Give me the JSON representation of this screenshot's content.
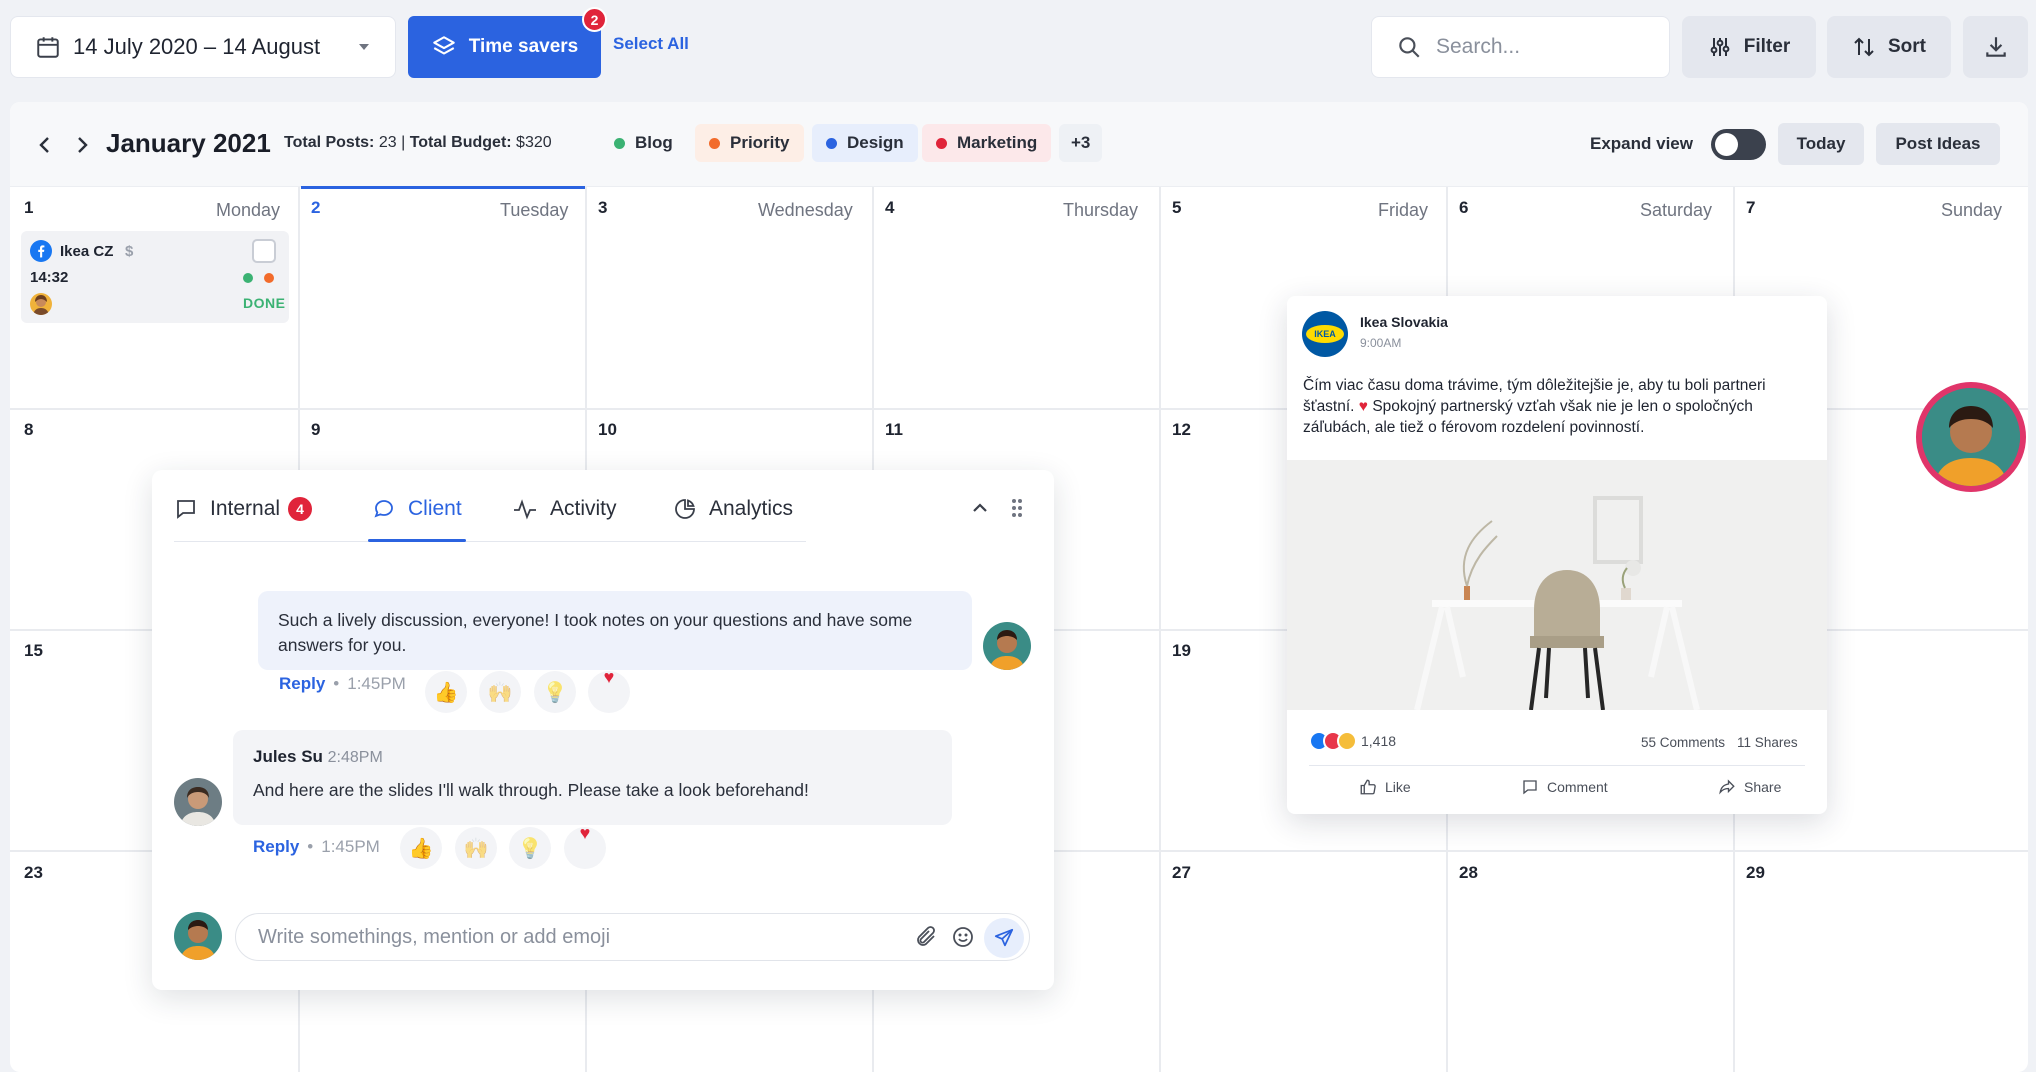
{
  "toolbar": {
    "date_range": "14 July 2020 – 14 August",
    "time_savers_label": "Time savers",
    "time_savers_badge": "2",
    "select_all": "Select All",
    "search_placeholder": "Search...",
    "filter_label": "Filter",
    "sort_label": "Sort"
  },
  "calendar_header": {
    "month": "January 2021",
    "totals_prefix": "Total Posts:",
    "total_posts": "23",
    "totals_sep": "|",
    "budget_prefix": "Total Budget:",
    "total_budget": "$320",
    "tags": [
      {
        "label": "Blog",
        "color": "#3bb273",
        "bg": "#eef1f5"
      },
      {
        "label": "Priority",
        "color": "#f26b2b",
        "bg": "#fdeee6"
      },
      {
        "label": "Design",
        "color": "#2b63e0",
        "bg": "#e7eefc"
      },
      {
        "label": "Marketing",
        "color": "#e0243a",
        "bg": "#fce8ea"
      },
      {
        "label": "+3",
        "color": "",
        "bg": "#eef1f5"
      }
    ],
    "expand_view": "Expand view",
    "today": "Today",
    "post_ideas": "Post Ideas"
  },
  "days": [
    {
      "num": "1",
      "name": "Monday"
    },
    {
      "num": "2",
      "name": "Tuesday"
    },
    {
      "num": "3",
      "name": "Wednesday"
    },
    {
      "num": "4",
      "name": "Thursday"
    },
    {
      "num": "5",
      "name": "Friday"
    },
    {
      "num": "6",
      "name": "Saturday"
    },
    {
      "num": "7",
      "name": "Sunday"
    }
  ],
  "weeks": [
    [
      "8",
      "9",
      "10",
      "11",
      "12",
      "",
      ""
    ],
    [
      "15",
      "",
      "",
      "",
      "19",
      "",
      ""
    ],
    [
      "23",
      "",
      "",
      "",
      "27",
      "28",
      "29"
    ]
  ],
  "post_card": {
    "account": "Ikea CZ",
    "currency": "$",
    "time": "14:32",
    "status": "DONE"
  },
  "comments": {
    "tabs": [
      {
        "label": "Internal",
        "badge": "4"
      },
      {
        "label": "Client"
      },
      {
        "label": "Activity"
      },
      {
        "label": "Analytics"
      }
    ],
    "thread": [
      {
        "text": "Such a lively discussion, everyone! I took notes on your questions and have some answers for you.",
        "reply": "Reply",
        "time": "1:45PM"
      },
      {
        "author": "Jules Su",
        "author_time": "2:48PM",
        "text": "And here are the slides I'll walk through. Please take a look beforehand!",
        "reply": "Reply",
        "time": "1:45PM"
      }
    ],
    "input_placeholder": "Write somethings, mention or add emoji"
  },
  "fb_post": {
    "page_name": "Ikea Slovakia",
    "time": "9:00AM",
    "logo_text": "IKEA",
    "text_part1": "Čím viac času doma trávime, tým dôležitejšie je, aby tu boli partneri šťastní.",
    "text_part2": "Spokojný partnerský vzťah však nie je len o spoločných záľubách, ale tiež o férovom rozdelení povinností.",
    "reactions_count": "1,418",
    "comments_count": "55 Comments",
    "shares_count": "11 Shares",
    "like": "Like",
    "comment": "Comment",
    "share": "Share"
  },
  "separator": "•"
}
